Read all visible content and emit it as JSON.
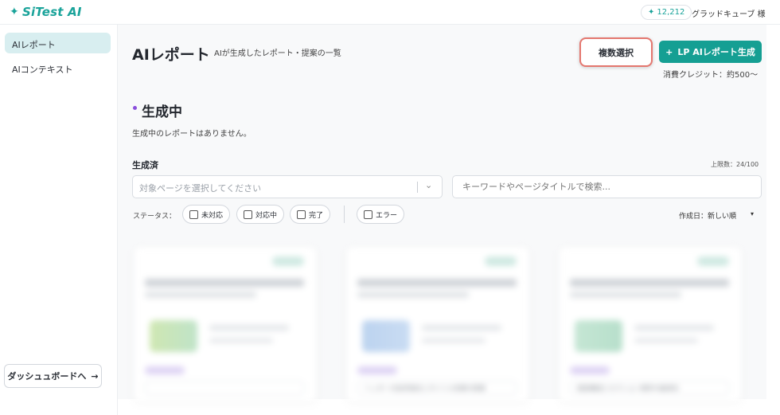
{
  "app": {
    "logo_text": "SiTest AI",
    "logo_mark": "✦"
  },
  "header": {
    "credits_icon": "✦",
    "credits_value": "12,212",
    "user_name": "グラッドキューブ 様"
  },
  "sidebar": {
    "items": [
      {
        "label": "AIレポート",
        "active": true
      },
      {
        "label": "AIコンテキスト",
        "active": false
      }
    ],
    "dashboard_button": "ダッシュュボードへ",
    "dashboard_arrow": "→"
  },
  "page": {
    "title": "AIレポート",
    "subtitle": "AIが生成したレポート・提案の一覧",
    "multi_select_label": "複数選択",
    "generate_icon": "+",
    "generate_label": "LP AIレポート生成",
    "credit_note": "消費クレジット：約500〜"
  },
  "generating": {
    "title": "生成中",
    "empty_message": "生成中のレポートはありません。"
  },
  "generated": {
    "title": "生成済",
    "limit_text": "上限数：24/100",
    "page_select_placeholder": "対象ページを選択してください",
    "search_placeholder": "キーワードやページタイトルで検索...",
    "status_label": "ステータス：",
    "status_filters": [
      "未対応",
      "対応中",
      "完了"
    ],
    "error_filter": "エラー",
    "sort_label": "作成日：新しい順",
    "sort_caret": "▾"
  },
  "cards": [
    {
      "footer": ""
    },
    {
      "footer": "ヘッダーの訴求強化とタイトル改善の提案"
    },
    {
      "footer": "画面構成とセクション順序の最適化"
    }
  ],
  "colors": {
    "brand": "#159f93",
    "active_nav": "#d8eef0",
    "highlight_border": "#e4776f",
    "section_dot": "#8a4fdc"
  }
}
